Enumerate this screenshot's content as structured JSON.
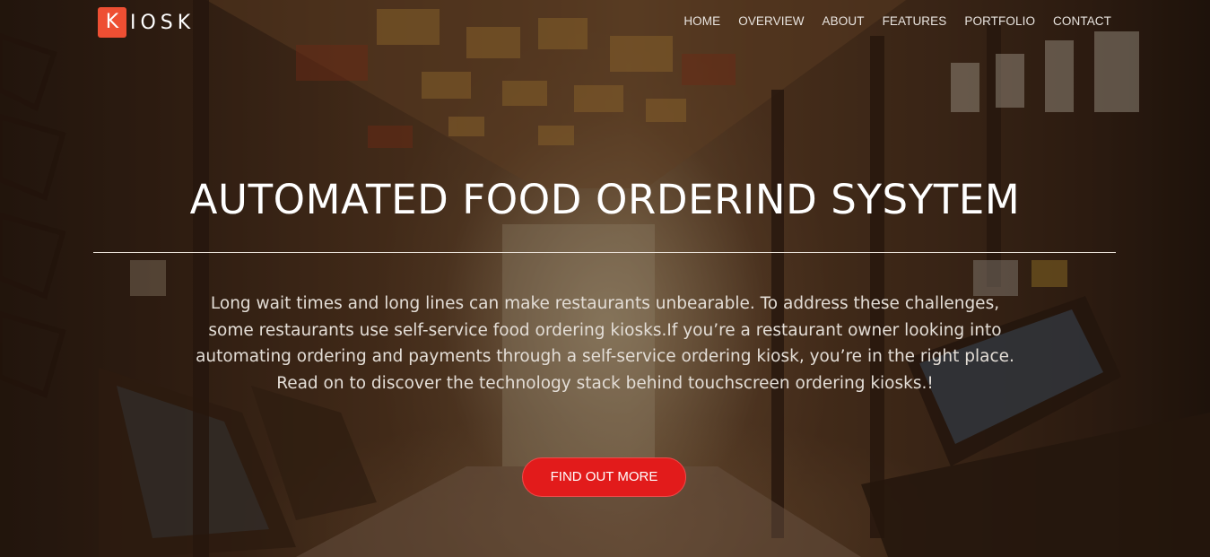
{
  "brand": {
    "mark_letter": "K",
    "rest": "IOSK",
    "mark_color": "#ee4f33"
  },
  "nav": {
    "items": [
      {
        "label": "HOME"
      },
      {
        "label": "OVERVIEW"
      },
      {
        "label": "ABOUT"
      },
      {
        "label": "FEATURES"
      },
      {
        "label": "PORTFOLIO"
      },
      {
        "label": "CONTACT"
      }
    ]
  },
  "hero": {
    "title": "AUTOMATED FOOD ORDERIND SYSYTEM",
    "description": "Long wait times and long lines can make restaurants unbearable. To address these challenges, some restaurants use self-service food ordering kiosks.If you’re a restaurant owner looking into automating ordering and payments through a self-service ordering kiosk, you’re in the right place. Read on to discover the technology stack behind touchscreen ordering kiosks.!",
    "cta_label": "FIND OUT MORE",
    "cta_color": "#e21b1b"
  }
}
